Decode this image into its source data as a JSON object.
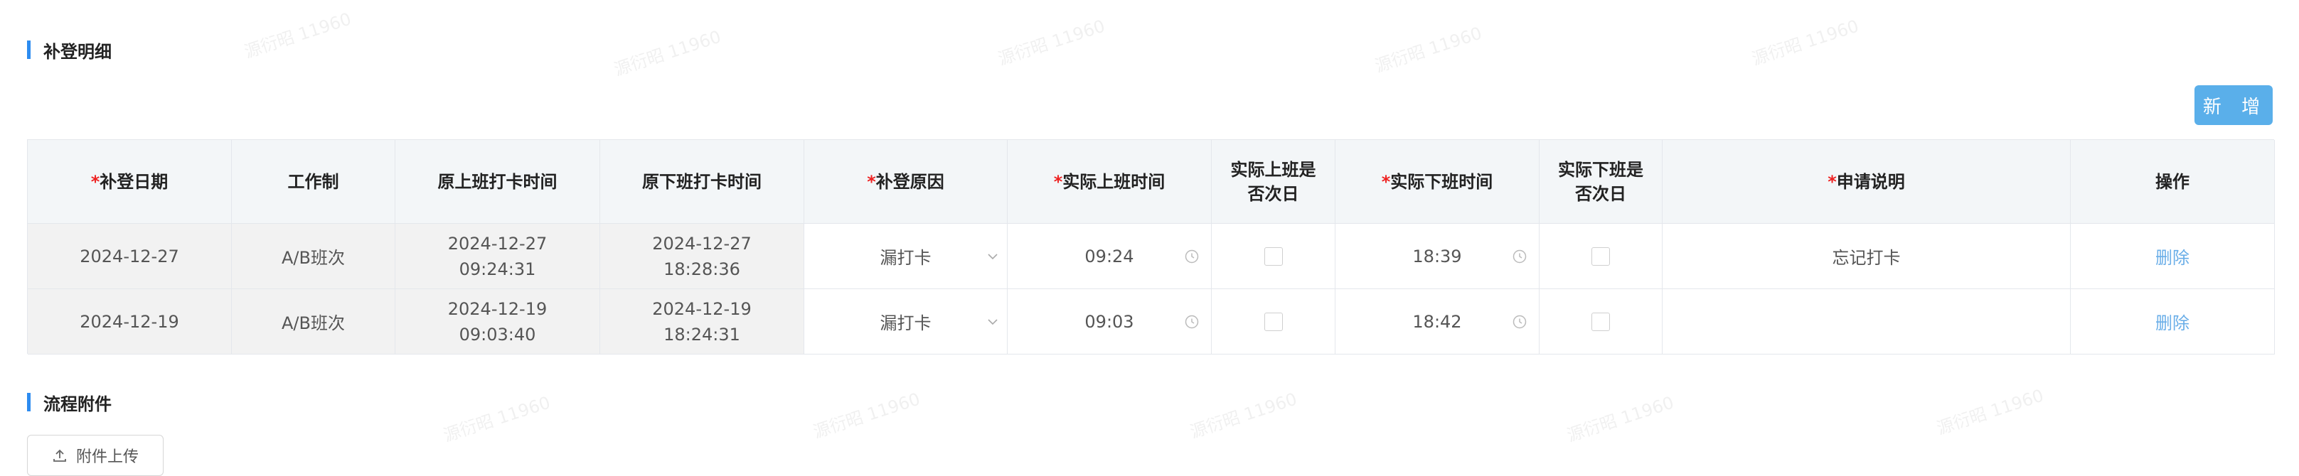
{
  "sections": {
    "detail_title": "补登明细",
    "attachment_title": "流程附件"
  },
  "toolbar": {
    "add_label": "新 增"
  },
  "table": {
    "headers": [
      {
        "required": true,
        "label": "补登日期"
      },
      {
        "required": false,
        "label": "工作制"
      },
      {
        "required": false,
        "label": "原上班打卡时间"
      },
      {
        "required": false,
        "label": "原下班打卡时间"
      },
      {
        "required": true,
        "label": "补登原因"
      },
      {
        "required": true,
        "label": "实际上班时间"
      },
      {
        "required": false,
        "label": "实际上班是\n否次日"
      },
      {
        "required": true,
        "label": "实际下班时间"
      },
      {
        "required": false,
        "label": "实际下班是\n否次日"
      },
      {
        "required": true,
        "label": "申请说明"
      },
      {
        "required": false,
        "label": "操作"
      }
    ],
    "required_mark": "*",
    "rows": [
      {
        "date": "2024-12-27",
        "work_system": "A/B班次",
        "orig_in_date": "2024-12-27",
        "orig_in_time": "09:24:31",
        "orig_out_date": "2024-12-27",
        "orig_out_time": "18:28:36",
        "reason": "漏打卡",
        "actual_in": "09:24",
        "actual_out": "18:39",
        "remark": "忘记打卡",
        "action": "删除"
      },
      {
        "date": "2024-12-19",
        "work_system": "A/B班次",
        "orig_in_date": "2024-12-19",
        "orig_in_time": "09:03:40",
        "orig_out_date": "2024-12-19",
        "orig_out_time": "18:24:31",
        "reason": "漏打卡",
        "actual_in": "09:03",
        "actual_out": "18:42",
        "remark": "",
        "action": "删除"
      }
    ]
  },
  "upload": {
    "label": "附件上传"
  },
  "watermark": {
    "text": "源衍昭 11960"
  },
  "colors": {
    "accent": "#2d8cf0",
    "button_bg": "#5aafea",
    "link": "#6aaee8",
    "required": "#ee2222",
    "header_bg": "#f3f6f8",
    "readonly_bg": "#f2f2f2"
  }
}
